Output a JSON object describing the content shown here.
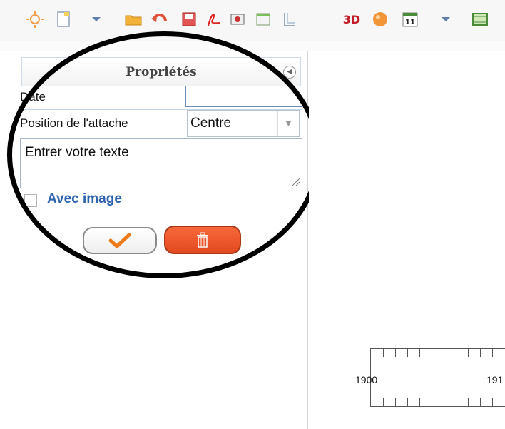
{
  "toolbar": {
    "icons": [
      "sun-icon",
      "new-document-icon",
      "dropdown-arrow-icon",
      "open-folder-icon",
      "undo-icon",
      "save-icon",
      "pdf-icon",
      "image-icon",
      "window-icon",
      "frame-icon",
      "3d-icon",
      "sphere-icon",
      "calendar-icon",
      "dropdown-arrow-icon",
      "film-icon"
    ],
    "label_3d": "3D",
    "calendar_day": "11"
  },
  "panel": {
    "title": "Propriétés",
    "date_label": "Date",
    "date_value": "",
    "position_label": "Position de l'attache",
    "position_value": "Centre",
    "text_placeholder": "Entrer votre texte",
    "with_image_label": "Avec image",
    "with_image_checked": false
  },
  "colors": {
    "accent_blue": "#2b63ad",
    "delete_orange": "#e24a1f",
    "confirm_orange": "#f07a1a"
  },
  "timeline": {
    "labels": [
      "1900",
      "191"
    ]
  }
}
